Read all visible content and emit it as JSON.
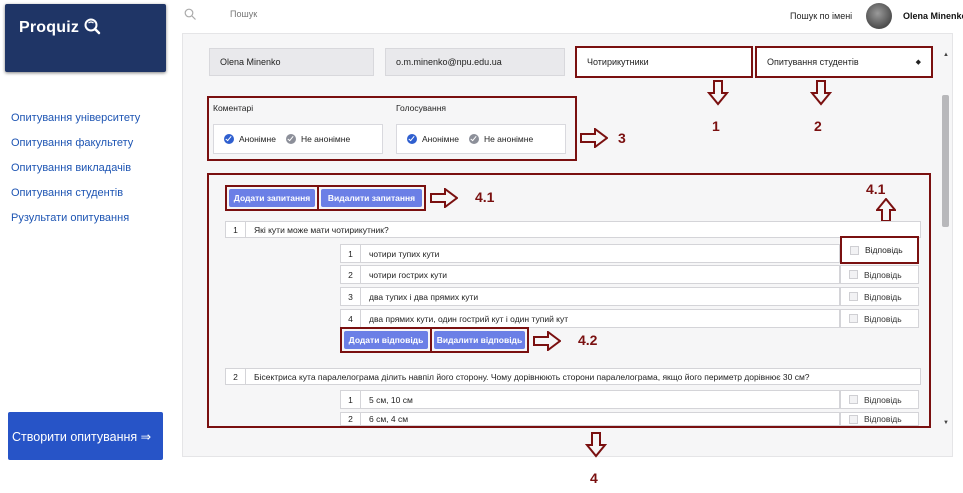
{
  "logo": {
    "text": "Proquiz"
  },
  "sidebar": {
    "items": [
      {
        "label": "Опитування університету"
      },
      {
        "label": "Опитування факультету"
      },
      {
        "label": "Опитування викладачів"
      },
      {
        "label": "Опитування студентів"
      },
      {
        "label": "Рузультати опитування"
      }
    ],
    "create_button": "Створити опитування ⇒"
  },
  "topbar": {
    "search_placeholder": "Пошук",
    "name_search": "Пошук по імені",
    "user_name": "Olena Minenko"
  },
  "form": {
    "name": "Olena Minenko",
    "email": "o.m.minenko@npu.edu.ua",
    "title": "Чотирикутники",
    "category": "Опитування студентів",
    "comments_label": "Коментарі",
    "voting_label": "Голосування",
    "anon_label": "Анонімне",
    "not_anon_label": "Не анонімне"
  },
  "question_buttons": {
    "add": "Додати запитання",
    "delete": "Видалити запитання"
  },
  "answer_buttons": {
    "add": "Додати відповідь",
    "delete": "Видалити відповідь"
  },
  "answer_label": "Відповідь",
  "questions": [
    {
      "num": "1",
      "text": "Які кути може мати чотирикутник?",
      "answers": [
        {
          "num": "1",
          "text": "чотири тупих кути"
        },
        {
          "num": "2",
          "text": "чотири гострих кути"
        },
        {
          "num": "3",
          "text": "два тупих і два прямих кути"
        },
        {
          "num": "4",
          "text": "два прямих кути, один гострий кут і один тупий кут"
        }
      ]
    },
    {
      "num": "2",
      "text": "Бісектриса кута паралелограма ділить навпіл його сторону. Чому дорівнюють сторони паралелограма, якщо його периметр дорівнює 30 см?",
      "answers": [
        {
          "num": "1",
          "text": "5 см, 10 см"
        },
        {
          "num": "2",
          "text": "6 см, 4 см"
        }
      ]
    }
  ],
  "annotations": {
    "a1": "1",
    "a2": "2",
    "a3": "3",
    "a41": "4.1",
    "a41b": "4.1",
    "a42": "4.2",
    "a4": "4"
  }
}
